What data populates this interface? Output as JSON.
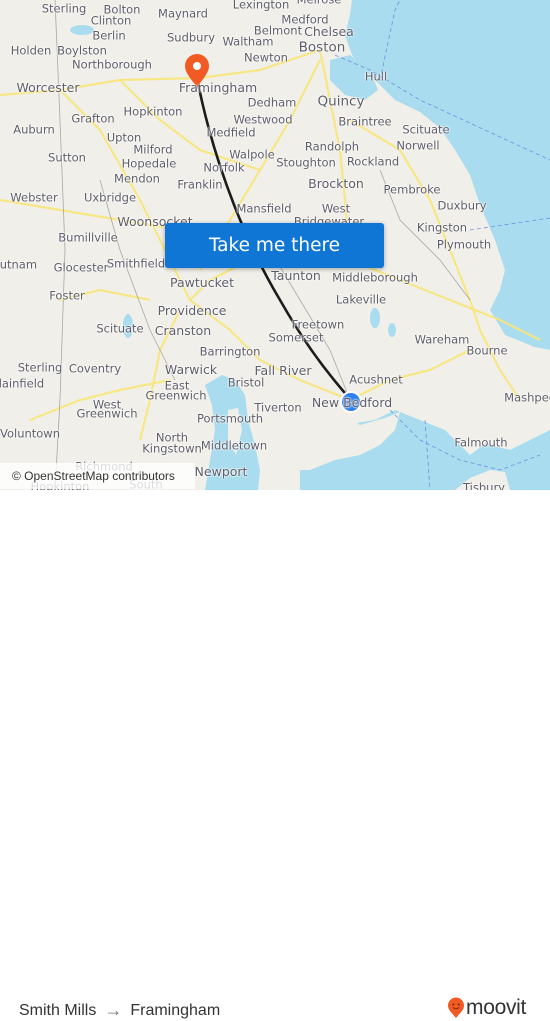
{
  "map": {
    "attribution": "© OpenStreetMap contributors",
    "colors": {
      "land": "#f1efe9",
      "water": "#a9dcee",
      "road": "#f8e77a",
      "route_line": "#1c1c1c",
      "destination_pin": "#f15a22",
      "origin_dot": "#2f80ed"
    },
    "places": [
      {
        "name": "Sterling",
        "size": "s"
      },
      {
        "name": "Bolton",
        "size": "s"
      },
      {
        "name": "Maynard",
        "size": "s"
      },
      {
        "name": "Lexington",
        "size": "s"
      },
      {
        "name": "Melrose",
        "size": "s"
      },
      {
        "name": "Clinton",
        "size": "s"
      },
      {
        "name": "Medford",
        "size": "s"
      },
      {
        "name": "Berlin",
        "size": "s"
      },
      {
        "name": "Belmont",
        "size": "s"
      },
      {
        "name": "Chelsea",
        "size": "m"
      },
      {
        "name": "Holden",
        "size": "s"
      },
      {
        "name": "Boylston",
        "size": "s"
      },
      {
        "name": "Sudbury",
        "size": "s"
      },
      {
        "name": "Waltham",
        "size": "s"
      },
      {
        "name": "Boston",
        "size": "l"
      },
      {
        "name": "Northborough",
        "size": "s"
      },
      {
        "name": "Newton",
        "size": "s"
      },
      {
        "name": "Hull",
        "size": "s"
      },
      {
        "name": "Worcester",
        "size": "m"
      },
      {
        "name": "Framingham",
        "size": "m"
      },
      {
        "name": "Dedham",
        "size": "s"
      },
      {
        "name": "Quincy",
        "size": "l"
      },
      {
        "name": "Hopkinton",
        "size": "s"
      },
      {
        "name": "Grafton",
        "size": "s"
      },
      {
        "name": "Westwood",
        "size": "s"
      },
      {
        "name": "Braintree",
        "size": "s"
      },
      {
        "name": "Auburn",
        "size": "s"
      },
      {
        "name": "Upton",
        "size": "s"
      },
      {
        "name": "Medfield",
        "size": "s"
      },
      {
        "name": "Scituate",
        "size": "s"
      },
      {
        "name": "Milford",
        "size": "s"
      },
      {
        "name": "Randolph",
        "size": "s"
      },
      {
        "name": "Norwell",
        "size": "s"
      },
      {
        "name": "Sutton",
        "size": "s"
      },
      {
        "name": "Hopedale",
        "size": "s"
      },
      {
        "name": "Walpole",
        "size": "s"
      },
      {
        "name": "Norfolk",
        "size": "s"
      },
      {
        "name": "Stoughton",
        "size": "s"
      },
      {
        "name": "Rockland",
        "size": "s"
      },
      {
        "name": "Mendon",
        "size": "s"
      },
      {
        "name": "Franklin",
        "size": "s"
      },
      {
        "name": "Brockton",
        "size": "m"
      },
      {
        "name": "Pembroke",
        "size": "s"
      },
      {
        "name": "Webster",
        "size": "s"
      },
      {
        "name": "Uxbridge",
        "size": "s"
      },
      {
        "name": "Duxbury",
        "size": "s"
      },
      {
        "name": "Mansfield",
        "size": "s"
      },
      {
        "name": "West",
        "size": "s"
      },
      {
        "name": "Bridgewater",
        "size": "s"
      },
      {
        "name": "Woonsocket",
        "size": "m"
      },
      {
        "name": "Kingston",
        "size": "s"
      },
      {
        "name": "Bumillville",
        "size": "s"
      },
      {
        "name": "Plymouth",
        "size": "s"
      },
      {
        "name": "Putnam",
        "size": "s"
      },
      {
        "name": "Glocester",
        "size": "s"
      },
      {
        "name": "Smithfield",
        "size": "s"
      },
      {
        "name": "Taunton",
        "size": "m"
      },
      {
        "name": "Middleborough",
        "size": "s"
      },
      {
        "name": "Pawtucket",
        "size": "m"
      },
      {
        "name": "Foster",
        "size": "s"
      },
      {
        "name": "Lakeville",
        "size": "s"
      },
      {
        "name": "Providence",
        "size": "m"
      },
      {
        "name": "Freetown",
        "size": "s"
      },
      {
        "name": "Scituate",
        "size": "s"
      },
      {
        "name": "Cranston",
        "size": "m"
      },
      {
        "name": "Somerset",
        "size": "s"
      },
      {
        "name": "Wareham",
        "size": "s"
      },
      {
        "name": "Barrington",
        "size": "s"
      },
      {
        "name": "Bourne",
        "size": "s"
      },
      {
        "name": "Sterling",
        "size": "s"
      },
      {
        "name": "Coventry",
        "size": "s"
      },
      {
        "name": "Warwick",
        "size": "m"
      },
      {
        "name": "Fall River",
        "size": "m"
      },
      {
        "name": "Plainfield",
        "size": "s"
      },
      {
        "name": "East",
        "size": "s"
      },
      {
        "name": "Bristol",
        "size": "s"
      },
      {
        "name": "Acushnet",
        "size": "s"
      },
      {
        "name": "Greenwich",
        "size": "s"
      },
      {
        "name": "Mashpee",
        "size": "s"
      },
      {
        "name": "West",
        "size": "s"
      },
      {
        "name": "New Bedford",
        "size": "m"
      },
      {
        "name": "Greenwich",
        "size": "s"
      },
      {
        "name": "Tiverton",
        "size": "s"
      },
      {
        "name": "Portsmouth",
        "size": "s"
      },
      {
        "name": "Voluntown",
        "size": "s"
      },
      {
        "name": "North",
        "size": "s"
      },
      {
        "name": "Kingstown",
        "size": "s"
      },
      {
        "name": "Middletown",
        "size": "s"
      },
      {
        "name": "Falmouth",
        "size": "s"
      },
      {
        "name": "Richmond",
        "size": "s"
      },
      {
        "name": "Newport",
        "size": "m"
      },
      {
        "name": "Hopkinton",
        "size": "s"
      },
      {
        "name": "South",
        "size": "s"
      },
      {
        "name": "Tisbury",
        "size": "s"
      }
    ]
  },
  "cta": {
    "label": "Take me there"
  },
  "footer": {
    "origin": "Smith Mills",
    "arrow": "→",
    "destination": "Framingham",
    "brand": "moovit"
  }
}
